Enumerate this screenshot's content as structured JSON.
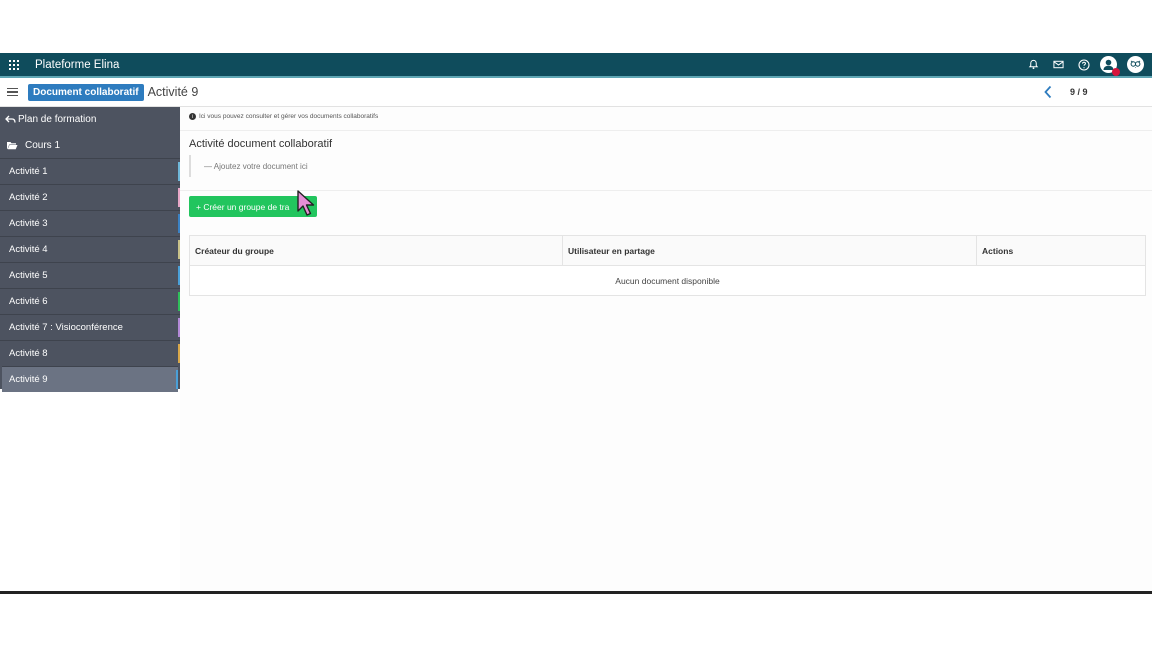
{
  "topbar": {
    "app_title": "Plateforme Elina",
    "icons": [
      "apps-grid-icon",
      "bell-icon",
      "mail-icon",
      "help-icon",
      "user-avatar",
      "owl-avatar"
    ]
  },
  "subbar": {
    "badge": "Document collaboratif",
    "title": "Activité 9",
    "pager": "9 / 9"
  },
  "sidebar": {
    "plan": "Plan de formation",
    "cours": "Cours 1",
    "items": [
      {
        "label": "Activité 1",
        "stripe": "#6fb7d9"
      },
      {
        "label": "Activité 2",
        "stripe": "#e8a8c8"
      },
      {
        "label": "Activité 3",
        "stripe": "#3b82c4"
      },
      {
        "label": "Activité 4",
        "stripe": "#c9c28a"
      },
      {
        "label": "Activité 5",
        "stripe": "#4aa0d8"
      },
      {
        "label": "Activité 6",
        "stripe": "#2fbf5a"
      },
      {
        "label": "Activité 7 : Visioconférence",
        "stripe": "#b48ad8"
      },
      {
        "label": "Activité 8",
        "stripe": "#d9a84a"
      },
      {
        "label": "Activité 9",
        "stripe": "#4aa0d8"
      }
    ]
  },
  "main": {
    "info": "Ici vous pouvez consulter et gérer vos documents collaboratifs",
    "section_title": "Activité document collaboratif",
    "placeholder": "— Ajoutez votre document ici",
    "create_button": "+ Créer un groupe de tra",
    "table": {
      "headers": [
        "Créateur du groupe",
        "Utilisateur en partage",
        "Actions"
      ],
      "empty": "Aucun document disponible"
    }
  },
  "colors": {
    "topbar": "#0f4c5c",
    "badge": "#2e7cbf",
    "sidebar": "#4d5360",
    "create_button": "#22c55e"
  }
}
